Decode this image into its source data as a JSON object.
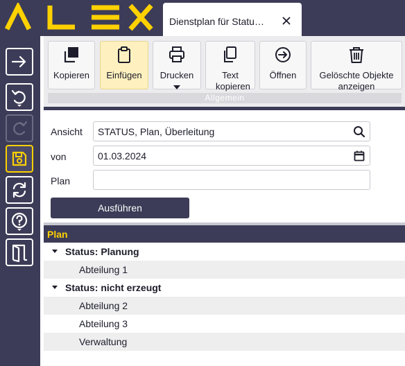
{
  "app": {
    "logo_text": "ALEX",
    "brand_color": "#ffd100",
    "chrome_color": "#3c3c58"
  },
  "tab": {
    "title": "Dienstplan für Statu…",
    "close_icon": "close-icon"
  },
  "sidebar": {
    "items": [
      {
        "icon": "arrow-right-icon",
        "state": "normal"
      },
      {
        "icon": "undo-icon",
        "state": "normal"
      },
      {
        "icon": "redo-icon",
        "state": "disabled"
      },
      {
        "icon": "save-icon",
        "state": "active"
      },
      {
        "icon": "refresh-icon",
        "state": "normal"
      },
      {
        "icon": "help-icon",
        "state": "normal"
      },
      {
        "icon": "exit-door-icon",
        "state": "normal"
      }
    ]
  },
  "toolbar": {
    "group_label": "Allgemein",
    "buttons": [
      {
        "label": "Kopieren",
        "icon": "copy-icon"
      },
      {
        "label": "Einfügen",
        "icon": "clipboard-icon",
        "highlighted": true
      },
      {
        "label": "Drucken",
        "icon": "printer-icon",
        "has_dropdown": true
      },
      {
        "label": "Text kopieren",
        "icon": "copy-text-icon"
      },
      {
        "label": "Öffnen",
        "icon": "open-arrow-icon"
      },
      {
        "label": "Gelöschte Objekte anzeigen",
        "icon": "trash-icon"
      }
    ]
  },
  "form": {
    "ansicht": {
      "label": "Ansicht",
      "value": "STATUS, Plan, Überleitung",
      "icon": "search-icon"
    },
    "von": {
      "label": "von",
      "value": "01.03.2024",
      "icon": "calendar-icon"
    },
    "plan": {
      "label": "Plan",
      "value": ""
    },
    "run_label": "Ausführen"
  },
  "tree": {
    "header": "Plan",
    "rows": [
      {
        "text": "Status: Planung",
        "level": 1,
        "expanded": true
      },
      {
        "text": "Abteilung 1",
        "level": 2
      },
      {
        "text": "Status: nicht erzeugt",
        "level": 1,
        "expanded": true
      },
      {
        "text": "Abteilung 2",
        "level": 2
      },
      {
        "text": "Abteilung 3",
        "level": 2
      },
      {
        "text": "Verwaltung",
        "level": 2
      }
    ]
  }
}
